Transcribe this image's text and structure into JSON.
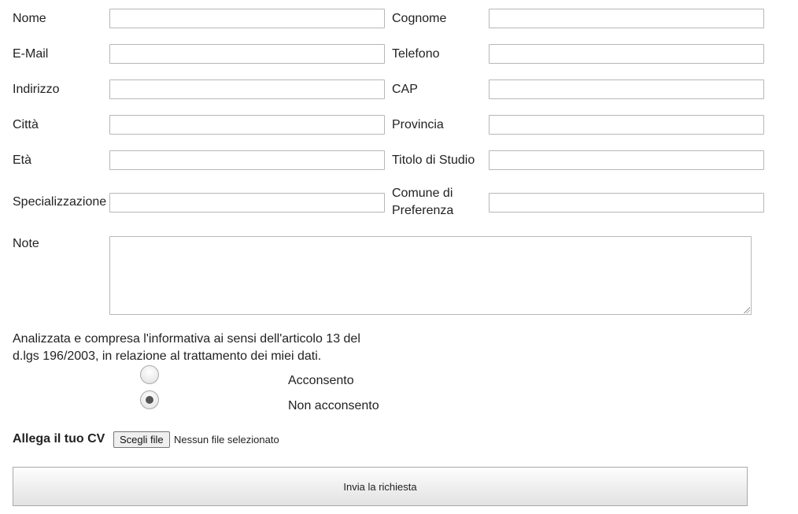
{
  "form": {
    "fields_left": [
      {
        "label": "Nome",
        "value": ""
      },
      {
        "label": "E-Mail",
        "value": ""
      },
      {
        "label": "Indirizzo",
        "value": ""
      },
      {
        "label": "Città",
        "value": ""
      },
      {
        "label": "Età",
        "value": ""
      },
      {
        "label": "Specializzazione",
        "value": ""
      }
    ],
    "fields_right": [
      {
        "label": "Cognome",
        "value": ""
      },
      {
        "label": "Telefono",
        "value": ""
      },
      {
        "label": "CAP",
        "value": ""
      },
      {
        "label": "Provincia",
        "value": ""
      },
      {
        "label": "Titolo di Studio",
        "value": ""
      },
      {
        "label": "Comune di Preferenza",
        "value": ""
      }
    ],
    "note": {
      "label": "Note",
      "value": ""
    },
    "privacy": {
      "text": "Analizzata e compresa l'informativa ai sensi dell'articolo 13 del d.lgs 196/2003, in relazione al trattamento dei miei dati.",
      "options": [
        {
          "label": "Acconsento",
          "selected": false
        },
        {
          "label": "Non acconsento",
          "selected": true
        }
      ]
    },
    "cv": {
      "label": "Allega il tuo CV",
      "button_label": "Scegli file",
      "status": "Nessun file selezionato"
    },
    "submit_label": "Invia la richiesta"
  }
}
